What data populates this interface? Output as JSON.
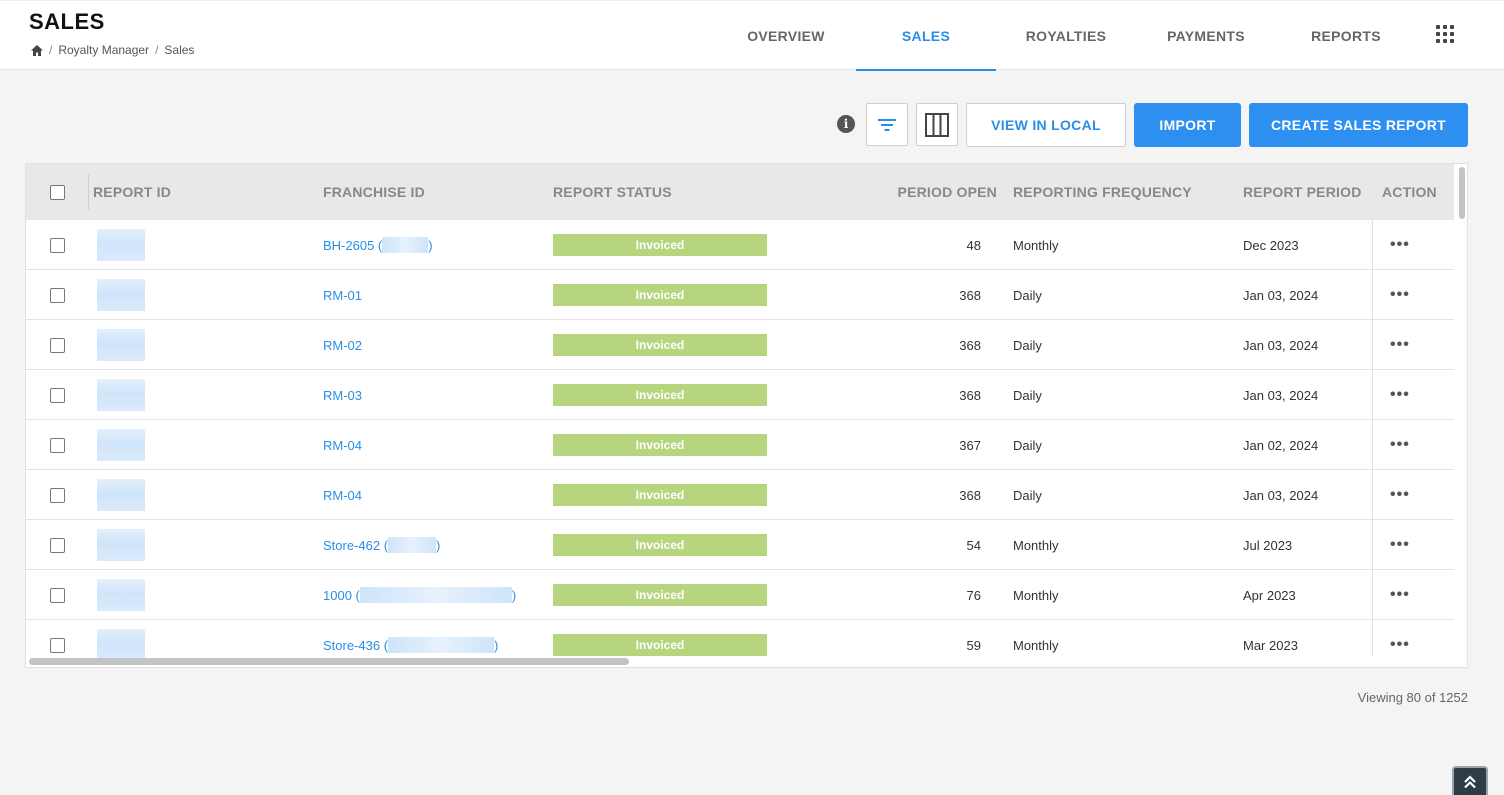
{
  "header": {
    "title": "SALES",
    "breadcrumb": [
      "Royalty Manager",
      "Sales"
    ],
    "tabs": [
      {
        "label": "OVERVIEW",
        "active": false
      },
      {
        "label": "SALES",
        "active": true
      },
      {
        "label": "ROYALTIES",
        "active": false
      },
      {
        "label": "PAYMENTS",
        "active": false
      },
      {
        "label": "REPORTS",
        "active": false
      }
    ]
  },
  "toolbar": {
    "info_icon": "i",
    "filter_icon": "filter-icon",
    "columns_icon": "columns-icon",
    "view_in_local_label": "VIEW IN LOCAL",
    "import_label": "IMPORT",
    "create_label": "CREATE SALES REPORT"
  },
  "table": {
    "columns": [
      "REPORT ID",
      "FRANCHISE ID",
      "REPORT STATUS",
      "PERIOD OPEN",
      "REPORTING FREQUENCY",
      "REPORT PERIOD",
      "ACTION"
    ],
    "rows": [
      {
        "franchise_id": "BH-2605 (",
        "franchise_suffix": ")",
        "blur_width": 46,
        "status": "Invoiced",
        "period_open": "48",
        "frequency": "Monthly",
        "report_period": "Dec 2023"
      },
      {
        "franchise_id": "RM-01",
        "franchise_suffix": "",
        "blur_width": 0,
        "status": "Invoiced",
        "period_open": "368",
        "frequency": "Daily",
        "report_period": "Jan 03, 2024"
      },
      {
        "franchise_id": "RM-02",
        "franchise_suffix": "",
        "blur_width": 0,
        "status": "Invoiced",
        "period_open": "368",
        "frequency": "Daily",
        "report_period": "Jan 03, 2024"
      },
      {
        "franchise_id": "RM-03",
        "franchise_suffix": "",
        "blur_width": 0,
        "status": "Invoiced",
        "period_open": "368",
        "frequency": "Daily",
        "report_period": "Jan 03, 2024"
      },
      {
        "franchise_id": "RM-04",
        "franchise_suffix": "",
        "blur_width": 0,
        "status": "Invoiced",
        "period_open": "367",
        "frequency": "Daily",
        "report_period": "Jan 02, 2024"
      },
      {
        "franchise_id": "RM-04",
        "franchise_suffix": "",
        "blur_width": 0,
        "status": "Invoiced",
        "period_open": "368",
        "frequency": "Daily",
        "report_period": "Jan 03, 2024"
      },
      {
        "franchise_id": "Store-462 (",
        "franchise_suffix": ")",
        "blur_width": 48,
        "status": "Invoiced",
        "period_open": "54",
        "frequency": "Monthly",
        "report_period": "Jul 2023"
      },
      {
        "franchise_id": "1000 (",
        "franchise_suffix": ")",
        "blur_width": 152,
        "status": "Invoiced",
        "period_open": "76",
        "frequency": "Monthly",
        "report_period": "Apr 2023"
      },
      {
        "franchise_id": "Store-436 (",
        "franchise_suffix": ")",
        "blur_width": 106,
        "status": "Invoiced",
        "period_open": "59",
        "frequency": "Monthly",
        "report_period": "Mar 2023"
      }
    ],
    "more_icon": "•••"
  },
  "footer": {
    "viewing_text": "Viewing 80 of 1252"
  },
  "colors": {
    "accent": "#2a8ee8",
    "status_invoiced": "#b7d47f"
  }
}
